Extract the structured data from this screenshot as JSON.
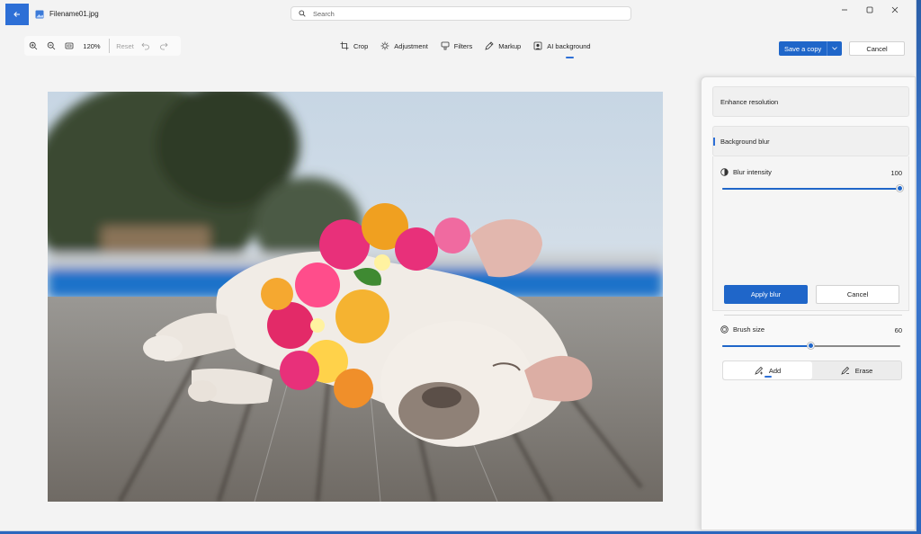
{
  "window": {
    "file_name": "Filename01.jpg"
  },
  "search": {
    "placeholder": "Search"
  },
  "toolbar": {
    "zoom_level": "120%",
    "reset_label": "Reset",
    "tools": [
      {
        "label": "Crop",
        "icon": "crop-icon"
      },
      {
        "label": "Adjustment",
        "icon": "adjustment-icon"
      },
      {
        "label": "Filters",
        "icon": "filters-icon"
      },
      {
        "label": "Markup",
        "icon": "markup-icon"
      },
      {
        "label": "AI background",
        "icon": "ai-background-icon",
        "active": true
      }
    ],
    "save_copy_label": "Save a copy",
    "cancel_label": "Cancel"
  },
  "panel": {
    "enhance_label": "Enhance resolution",
    "background_blur_label": "Background blur",
    "blur_intensity": {
      "label": "Blur intensity",
      "value": "100",
      "fraction": 1.0
    },
    "apply_label": "Apply blur",
    "cancel_label": "Cancel",
    "brush_size": {
      "label": "Brush size",
      "value": "60",
      "fraction": 0.5
    },
    "brush_modes": [
      {
        "label": "Add",
        "active": true
      },
      {
        "label": "Erase",
        "active": false
      }
    ]
  },
  "colors": {
    "accent": "#1f66c9",
    "window_bg": "#f3f3f3"
  }
}
